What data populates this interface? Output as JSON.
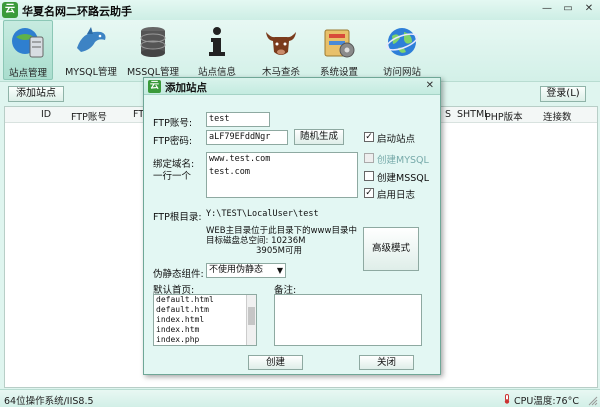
{
  "app": {
    "title": "华夏名网二环路云助手",
    "window_buttons": [
      "—",
      "▭",
      "✕"
    ]
  },
  "toolbar": [
    {
      "label": "站点管理",
      "icon": "server-icon"
    },
    {
      "label": "MYSQL管理",
      "icon": "dolphin-icon"
    },
    {
      "label": "MSSQL管理",
      "icon": "database-icon"
    },
    {
      "label": "站点信息",
      "icon": "info-icon"
    },
    {
      "label": "木马查杀",
      "icon": "bull-icon"
    },
    {
      "label": "系统设置",
      "icon": "settings-icon"
    },
    {
      "label": "访问网站",
      "icon": "globe-icon"
    }
  ],
  "main": {
    "add_site_label": "添加站点",
    "login_label": "登录(L)",
    "columns": [
      "ID",
      "FTP账号",
      "FT",
      "SHTML",
      "PHP版本",
      "连接数"
    ],
    "columns_hidden_part": "S"
  },
  "dialog": {
    "title": "添加站点",
    "close": "✕",
    "ftp_account_label": "FTP账号:",
    "ftp_account_value": "test",
    "ftp_password_label": "FTP密码:",
    "ftp_password_value": "aLF79EFddNgr",
    "random_button": "随机生成",
    "domain_label": "绑定域名:",
    "domain_hint": "一行一个",
    "domain_lines": [
      "www.test.com",
      "test.com"
    ],
    "ftp_root_label": "FTP根目录:",
    "ftp_root_value": "Y:\\TEST\\LocalUser\\test",
    "web_note": "WEB主目录位于此目录下的www目录中",
    "disk_space_line1": "目标磁盘总空间: 10236M",
    "disk_space_line2": "3905M可用",
    "advanced_button": "高级模式",
    "pseudo_static_label": "伪静态组件:",
    "pseudo_static_value": "不使用伪静态",
    "default_page_label": "默认首页:",
    "default_pages": [
      "default.html",
      "default.htm",
      "index.html",
      "index.htm",
      "index.php"
    ],
    "remark_label": "备注:",
    "remark_value": "",
    "checkboxes": [
      {
        "label": "启动站点",
        "checked": true,
        "disabled": false
      },
      {
        "label": "创建MYSQL",
        "checked": false,
        "disabled": true
      },
      {
        "label": "创建MSSQL",
        "checked": false,
        "disabled": false
      },
      {
        "label": "启用日志",
        "checked": true,
        "disabled": false
      }
    ],
    "create_button": "创建",
    "close_button": "关闭"
  },
  "status": {
    "os": "64位操作系统/IIS8.5",
    "cpu_temp": "CPU温度:76°C"
  }
}
